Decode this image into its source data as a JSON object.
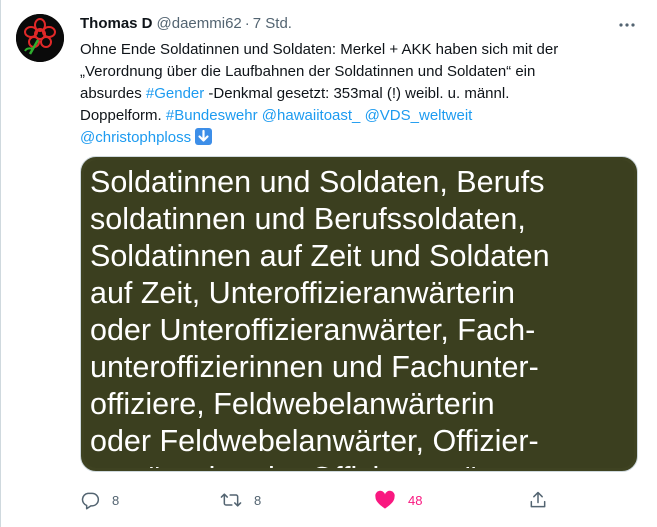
{
  "tweet": {
    "author_name": "Thomas D",
    "author_handle": "@daemmi62",
    "separator": "·",
    "time": "7 Std.",
    "text_lines": [
      "Ohne Ende Soldatinnen und Soldaten: Merkel + AKK haben sich mit der",
      "„Verordnung über die Laufbahnen der Soldatinnen und Soldaten“ ein"
    ],
    "line3_prefix": "absurdes ",
    "hashtag_gender": "#Gender",
    "line3_suffix": " -Denkmal gesetzt: 353mal (!) weibl. u. männl.",
    "line4_prefix": "Doppelform. ",
    "hashtag_bundeswehr": "#Bundeswehr",
    "mention_hawaiitoast": "@hawaiitoast_",
    "mention_vds": "@VDS_weltweit",
    "mention_christophploss": "@christophploss",
    "emoji": "down-arrow-emoji"
  },
  "media": {
    "lines": [
      "Soldatinnen und Soldaten, Berufs",
      "soldatinnen und Berufssoldaten,",
      "Soldatinnen auf Zeit und Soldaten",
      "auf Zeit, Unteroffizieranwärterin",
      "oder Unteroffizieranwärter, Fach-",
      "unteroffizierinnen und Fachunter-",
      "offiziere, Feldwebelanwärterin",
      "oder Feldwebelanwärter, Offizier-",
      "anwärterin oder Offizieranwärter"
    ],
    "bg_color": "#3b3f1f"
  },
  "actions": {
    "reply_count": "8",
    "retweet_count": "8",
    "like_count": "48",
    "like_color": "#f91880",
    "icon_color": "#536471"
  }
}
